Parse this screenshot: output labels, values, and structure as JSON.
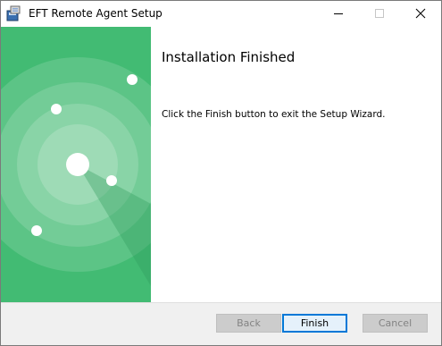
{
  "window": {
    "title": "EFT Remote Agent Setup"
  },
  "content": {
    "heading": "Installation Finished",
    "message": "Click the Finish button to exit the Setup Wizard."
  },
  "buttons": {
    "back": "Back",
    "finish": "Finish",
    "cancel": "Cancel"
  },
  "colors": {
    "banner_green": "#42bb73",
    "accent_blue": "#0078d7"
  },
  "icons": {
    "app": "installer-icon",
    "minimize": "minimize-icon",
    "maximize": "maximize-icon",
    "close": "close-icon"
  }
}
